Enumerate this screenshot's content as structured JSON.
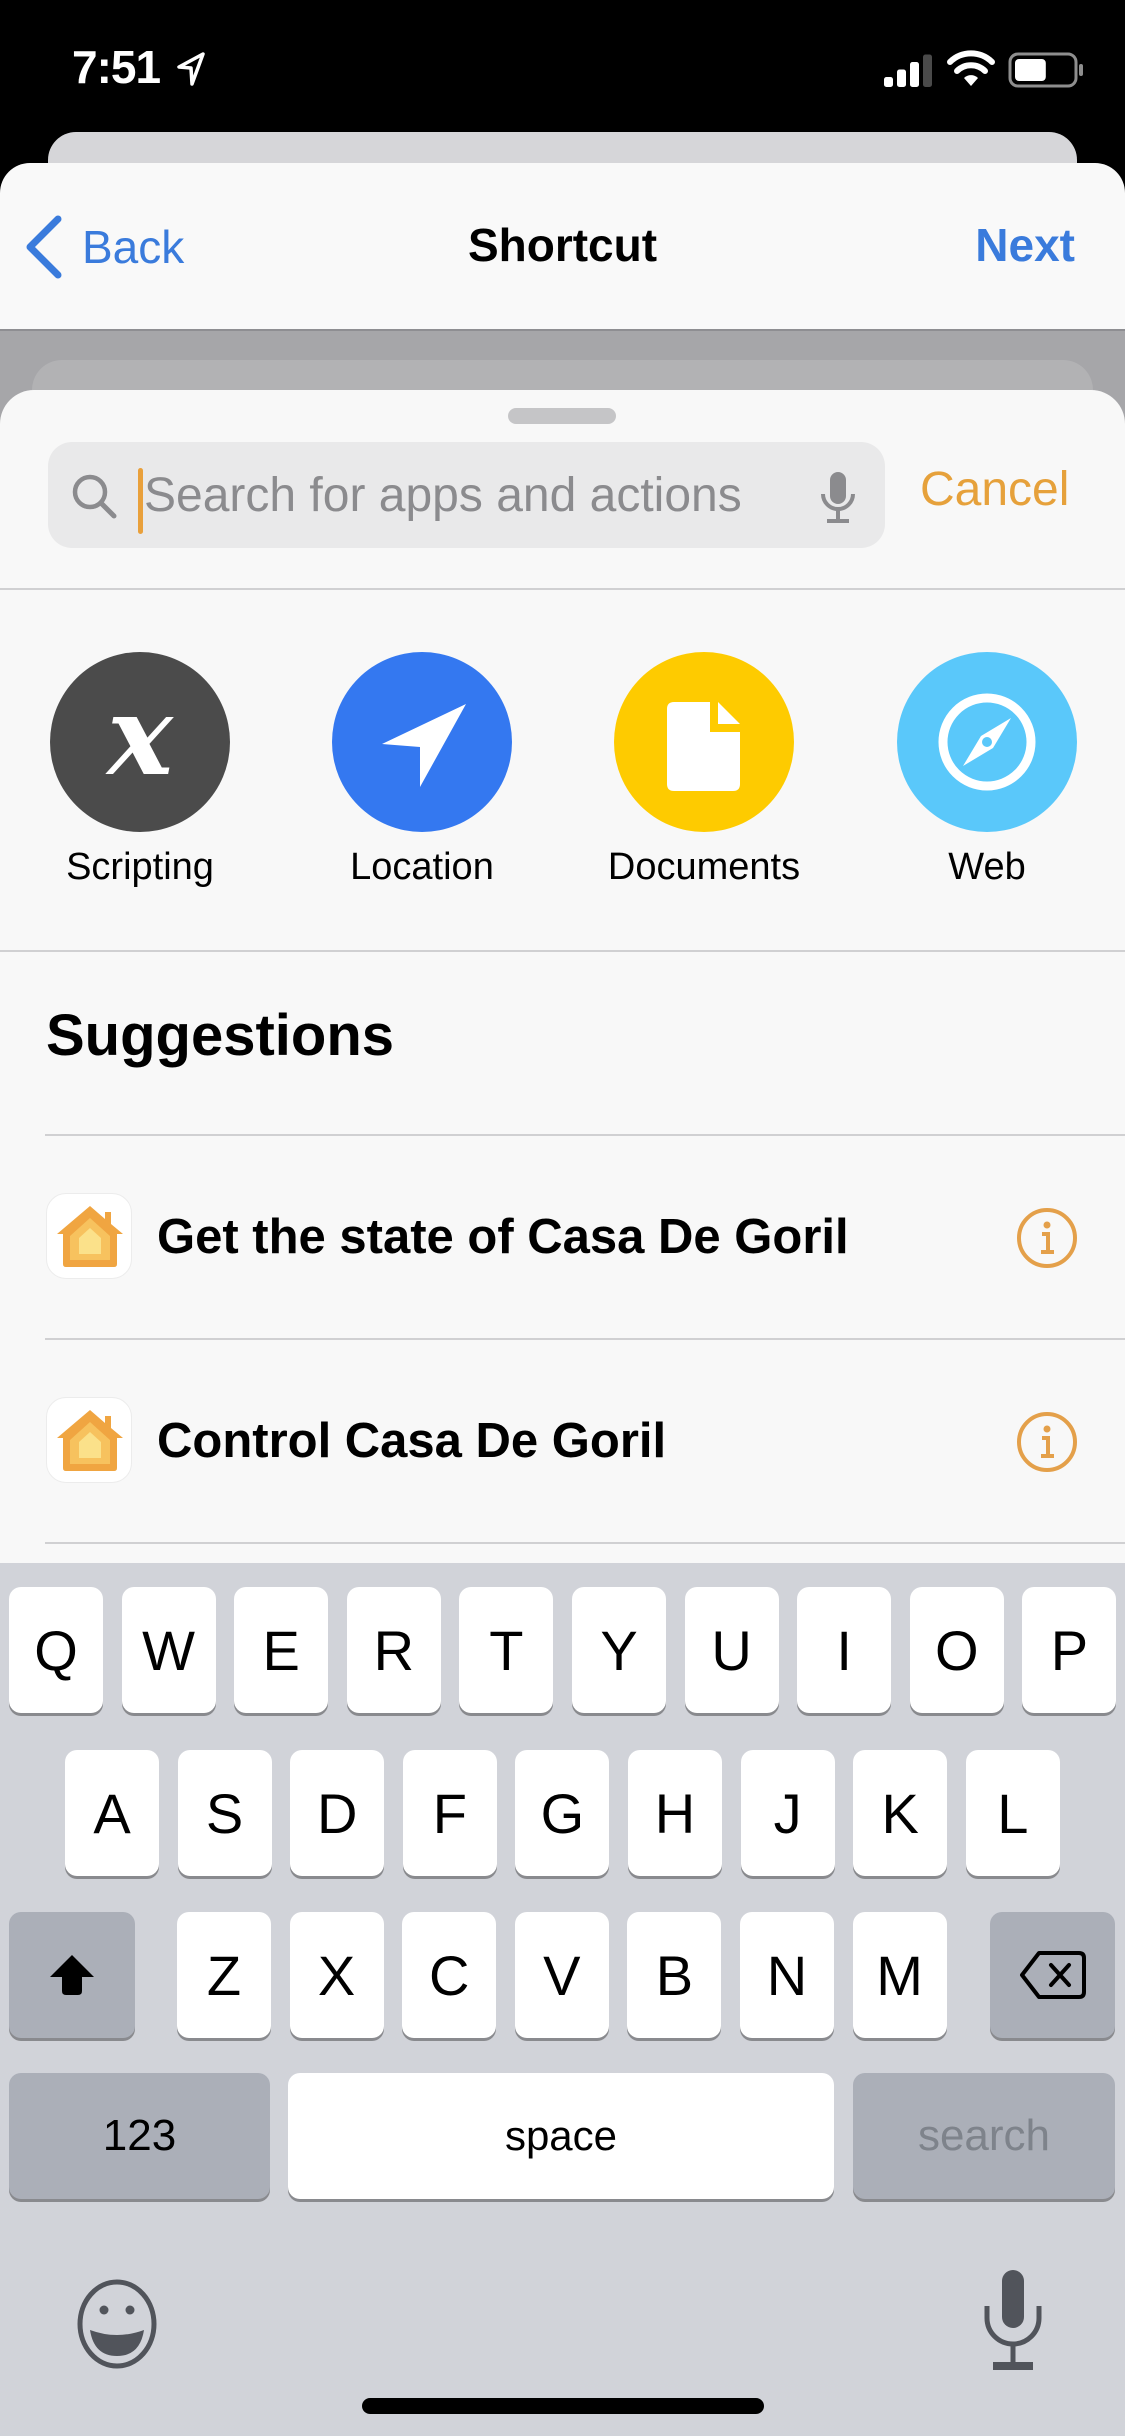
{
  "status_bar": {
    "time": "7:51",
    "location_icon": "location-arrow-icon",
    "signal_bars": 3,
    "signal_bars_total": 4,
    "wifi_icon": "wifi-icon",
    "battery_level_fraction": 0.55
  },
  "nav": {
    "back_label": "Back",
    "title": "Shortcut",
    "next_label": "Next",
    "accent_color": "#3a7bdc"
  },
  "search": {
    "placeholder": "Search for apps and actions",
    "value": "",
    "cancel_label": "Cancel",
    "accent_color": "#e6a13b"
  },
  "categories": [
    {
      "label": "Scripting",
      "icon": "variable-x-icon",
      "color": "#4b4b4b"
    },
    {
      "label": "Location",
      "icon": "location-arrow-icon",
      "color": "#3478f0"
    },
    {
      "label": "Documents",
      "icon": "document-icon",
      "color": "#fecb00"
    },
    {
      "label": "Web",
      "icon": "compass-icon",
      "color": "#5ac8fa"
    }
  ],
  "suggestions": {
    "title": "Suggestions",
    "items": [
      {
        "label": "Get the state of Casa De Goril",
        "app_icon": "home-app-icon"
      },
      {
        "label": "Control Casa De Goril",
        "app_icon": "home-app-icon"
      }
    ]
  },
  "keyboard": {
    "rows": [
      [
        "Q",
        "W",
        "E",
        "R",
        "T",
        "Y",
        "U",
        "I",
        "O",
        "P"
      ],
      [
        "A",
        "S",
        "D",
        "F",
        "G",
        "H",
        "J",
        "K",
        "L"
      ],
      [
        "Z",
        "X",
        "C",
        "V",
        "B",
        "N",
        "M"
      ]
    ],
    "numbers_label": "123",
    "space_label": "space",
    "return_label": "search"
  }
}
